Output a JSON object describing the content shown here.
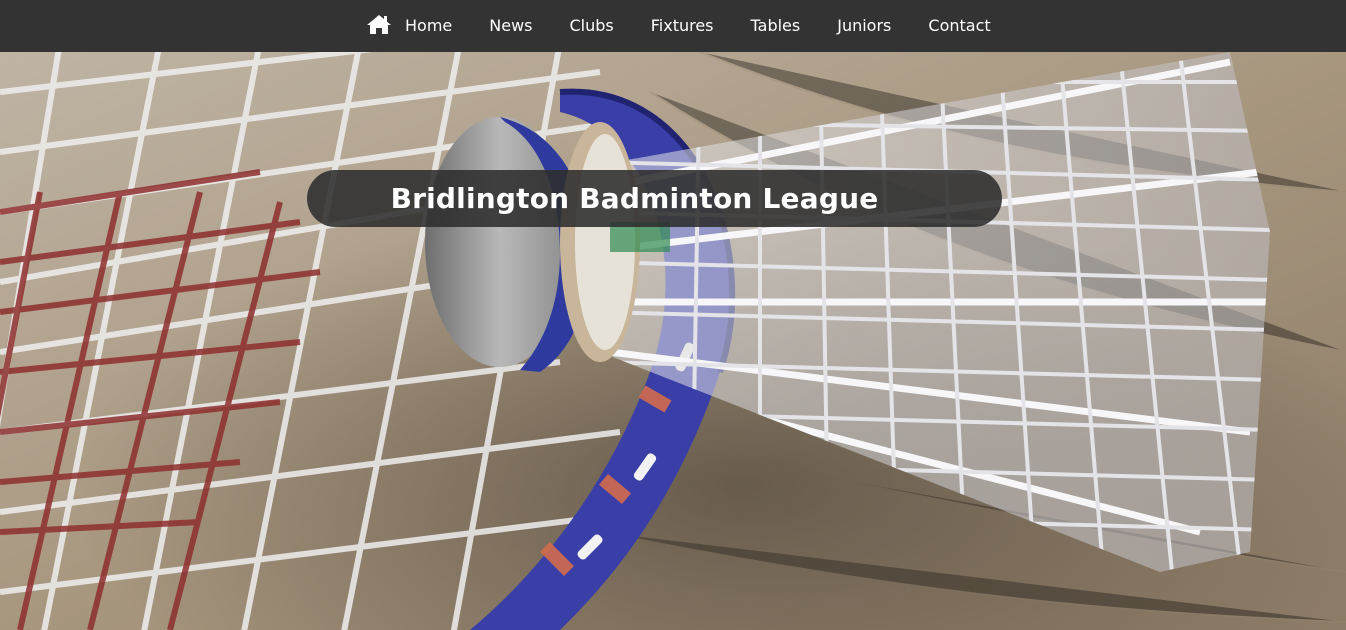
{
  "nav": {
    "home_icon": "home-icon",
    "items": [
      "Home",
      "News",
      "Clubs",
      "Fixtures",
      "Tables",
      "Juniors",
      "Contact"
    ]
  },
  "hero": {
    "title": "Bridlington Badminton League"
  },
  "colors": {
    "navbar_bg": "#333333",
    "nav_text": "#ffffff",
    "title_pill_bg": "#2d2d2d",
    "title_text": "#ffffff"
  }
}
